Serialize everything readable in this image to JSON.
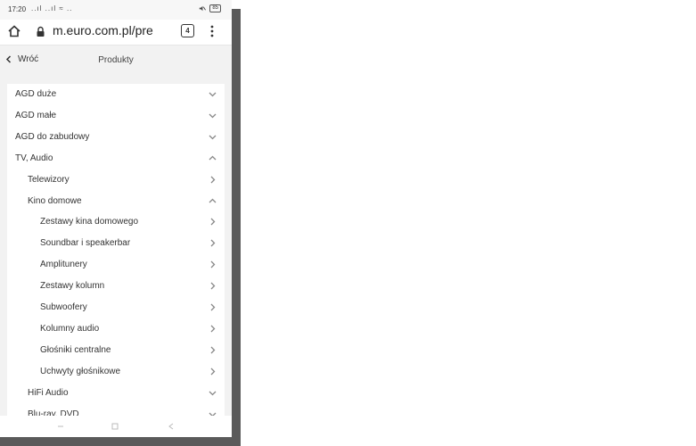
{
  "status_bar": {
    "time": "17:20",
    "signal": "..ıl ..ıl ≈ ..",
    "battery": "85"
  },
  "address_bar": {
    "url": "m.euro.com.pl/pre",
    "tab_count": "4"
  },
  "header": {
    "back_label": "Wróć",
    "title": "Produkty"
  },
  "menu": {
    "items": [
      {
        "label": "AGD duże",
        "level": 0,
        "expanded": false
      },
      {
        "label": "AGD małe",
        "level": 0,
        "expanded": false
      },
      {
        "label": "AGD do zabudowy",
        "level": 0,
        "expanded": false
      },
      {
        "label": "TV, Audio",
        "level": 0,
        "expanded": true
      },
      {
        "label": "Telewizory",
        "level": 1,
        "expanded": false,
        "arrow": "right"
      },
      {
        "label": "Kino domowe",
        "level": 1,
        "expanded": true
      },
      {
        "label": "Zestawy kina domowego",
        "level": 2,
        "arrow": "right"
      },
      {
        "label": "Soundbar i speakerbar",
        "level": 2,
        "arrow": "right"
      },
      {
        "label": "Amplitunery",
        "level": 2,
        "arrow": "right"
      },
      {
        "label": "Zestawy kolumn",
        "level": 2,
        "arrow": "right"
      },
      {
        "label": "Subwoofery",
        "level": 2,
        "arrow": "right"
      },
      {
        "label": "Kolumny audio",
        "level": 2,
        "arrow": "right"
      },
      {
        "label": "Głośniki centralne",
        "level": 2,
        "arrow": "right"
      },
      {
        "label": "Uchwyty głośnikowe",
        "level": 2,
        "arrow": "right"
      },
      {
        "label": "HiFi Audio",
        "level": 1,
        "expanded": false
      },
      {
        "label": "Blu-ray, DVD",
        "level": 1,
        "expanded": false
      }
    ]
  },
  "icons": {
    "home": "home-icon",
    "lock": "lock-icon",
    "menu": "more-vert-icon",
    "chev_down": "chevron-down-icon",
    "chev_up": "chevron-up-icon",
    "chev_right": "chevron-right-icon"
  },
  "colors": {
    "page_bg": "#f2f2f2",
    "list_bg": "#ffffff",
    "text": "#333333",
    "chevron": "#888888"
  }
}
